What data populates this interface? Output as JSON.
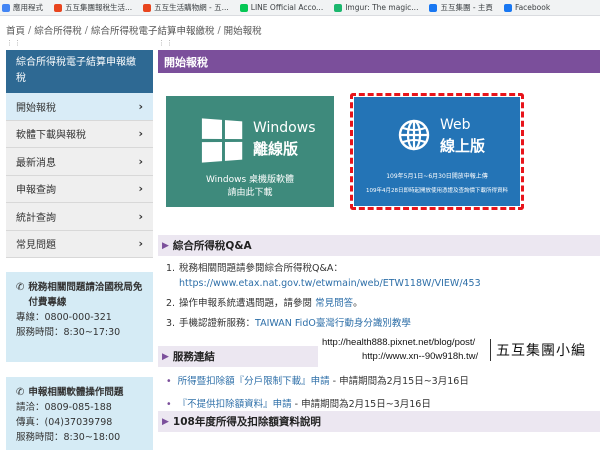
{
  "bookmarks": [
    {
      "label": "應用程式",
      "color": "#4285f4"
    },
    {
      "label": "五互集團報稅生活...",
      "color": "#e8451e"
    },
    {
      "label": "五互生活購物網 - 五...",
      "color": "#e8451e"
    },
    {
      "label": "LINE Official Acco...",
      "color": "#06c755"
    },
    {
      "label": "Imgur: The magic...",
      "color": "#1bb76e"
    },
    {
      "label": "五互集團 - 主頁",
      "color": "#1877f2"
    },
    {
      "label": "Facebook",
      "color": "#1877f2"
    }
  ],
  "breadcrumb": [
    "首頁",
    "綜合所得稅",
    "綜合所得稅電子結算申報繳稅",
    "開始報稅"
  ],
  "sidebar": {
    "title": "綜合所得稅電子結算申報繳稅",
    "items": [
      {
        "label": "開始報稅"
      },
      {
        "label": "軟體下載與報稅"
      },
      {
        "label": "最新消息"
      },
      {
        "label": "申報查詢"
      },
      {
        "label": "統計查詢"
      },
      {
        "label": "常見問題"
      }
    ],
    "box1": {
      "heading": "稅務相關問題請洽國稅局免付費專線",
      "lines": [
        "專線：0800-000-321",
        "服務時間：8:30~17:30"
      ]
    },
    "box2": {
      "heading": "申報相關軟體操作問題",
      "lines": [
        "請洽：0809-085-188",
        "傳真：(04)37039798",
        "服務時間：8:30~18:00"
      ]
    }
  },
  "main": {
    "header": "開始報稅",
    "windows_tile": {
      "title": "Windows",
      "subtitle": "離線版",
      "desc1": "Windows 桌機版軟體",
      "desc2": "請由此下載"
    },
    "web_tile": {
      "title": "Web",
      "subtitle": "線上版",
      "desc1": "109年5月1日~6月30日開放申報上傳",
      "desc2": "109年4月28日即時起開放使用憑證及查詢價下載所得資料"
    },
    "qa": {
      "heading": "綜合所得稅Q&A",
      "item1_text": "稅務相關問題請參閱綜合所得稅Q&A：",
      "item1_url": "https://www.etax.nat.gov.tw/etwmain/web/ETW118W/VIEW/453",
      "item2_text": "操作申報系統遭遇問題，請參閱 ",
      "item2_link": "常見問答",
      "item2_end": "。",
      "item3_text": "手機認證新服務：",
      "item3_link": "TAIWAN FidO臺灣行動身分識別教學"
    },
    "services": {
      "heading": "服務連結",
      "item1_link": "所得暨扣除額『分戶限制下載』申請",
      "item1_rest": " - 申請期間為2月15日~3月16日",
      "item2_link": "『不提供扣除額資料』申請",
      "item2_rest": " - 申請期間為2月15日~3月16日"
    },
    "data_section": {
      "heading": "108年度所得及扣除額資料說明"
    }
  },
  "watermark": {
    "url1": "http://health888.pixnet.net/blog/post/",
    "url2": "http://www.xn--90w918h.tw/",
    "name": "五互集團小編"
  },
  "colors": {
    "accent_purple": "#7b4f9b",
    "sidebar_blue": "#2e6993",
    "windows_green": "#3e8a7c",
    "web_blue": "#2474b6",
    "highlight_red": "#e8141b"
  }
}
